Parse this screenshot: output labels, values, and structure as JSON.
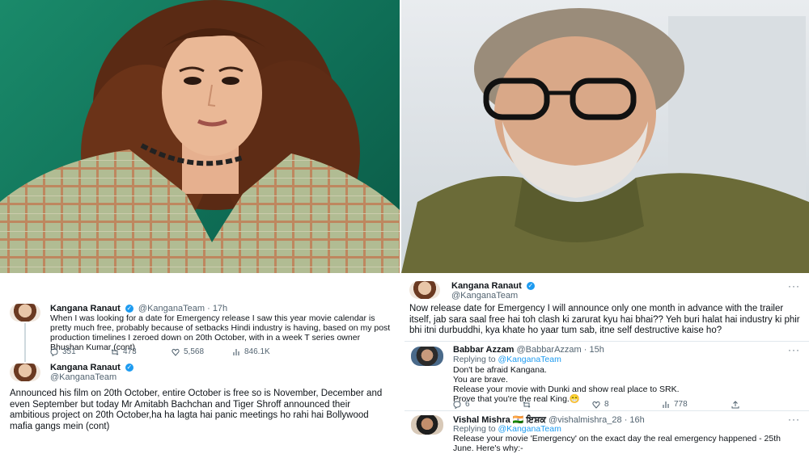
{
  "photos": {
    "left": {
      "subject": "woman-portrait"
    },
    "right": {
      "subject": "man-portrait"
    }
  },
  "left_panel": {
    "tweet1": {
      "name": "Kangana Ranaut",
      "handle": "@KanganaTeam",
      "time": "· 17h",
      "text": "When I was looking for a date for Emergency release I saw this year movie calendar is pretty much free, probably because of setbacks Hindi industry is having, based on my post production timelines I zeroed down on 20th October, with in a week T series owner Bhushan Kumar (cont)",
      "stats": {
        "replies": "351",
        "retweets": "473",
        "likes": "5,568",
        "views": "846.1K"
      }
    },
    "tweet2": {
      "name": "Kangana Ranaut",
      "handle": "@KanganaTeam",
      "text": "Announced his film on 20th October, entire October is free so is November, December and even September but today Mr Amitabh Bachchan and Tiger Shroff announced their ambitious project on 20th October,ha ha lagta hai panic meetings ho rahi hai Bollywood mafia gangs mein (cont)"
    }
  },
  "right_panel": {
    "tweet1": {
      "name": "Kangana Ranaut",
      "handle": "@KanganaTeam",
      "more": "···",
      "text": "Now release date for Emergency I will announce only one month in advance with the trailer itself, jab sara saal free hai toh clash ki zarurat kyu hai bhai?? Yeh buri halat hai industry ki phir bhi itni durbuddhi, kya khate ho yaar tum sab, itne self destructive kaise ho?"
    },
    "reply1": {
      "name": "Babbar Azzam",
      "handle": "@BabbarAzzam",
      "time": "· 15h",
      "replying_label": "Replying to",
      "replying_to": "@KanganaTeam",
      "more": "···",
      "lines": [
        "Don't be afraid Kangana.",
        "You are brave.",
        "Release your movie with Dunki and show real place to SRK.",
        "Prove that you're the real King.😁"
      ],
      "stats": {
        "replies": "6",
        "retweets": "",
        "likes": "8",
        "views": "778"
      }
    },
    "reply2": {
      "name": "Vishal Mishra 🇮🇳 ਇਸ਼ਕ",
      "handle": "@vishalmishra_28",
      "time": "· 16h",
      "replying_label": "Replying to",
      "replying_to": "@KanganaTeam",
      "more": "···",
      "text": "Release your movie 'Emergency' on the exact day the real emergency happened - 25th June. Here's why:-"
    }
  }
}
